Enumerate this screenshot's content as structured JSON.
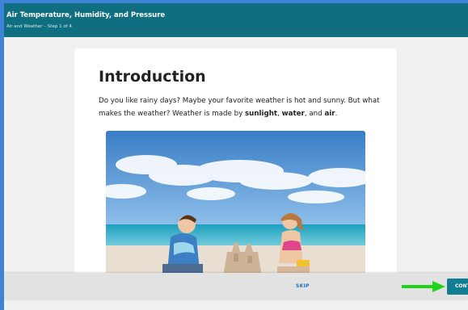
{
  "header": {
    "title": "Air Temperature, Humidity, and Pressure",
    "subtitle": "Air and Weather – Step 1 of 4"
  },
  "lesson": {
    "heading": "Introduction",
    "text_1": "Do you like rainy days? Maybe your favorite weather is hot and sunny. But what makes the weather? Weather is made by ",
    "word_sunlight": "sunlight",
    "sep_1": ", ",
    "word_water": "water",
    "sep_2": ", and ",
    "word_air": "air",
    "end": "."
  },
  "footer": {
    "skip_label": "SKIP",
    "continue_label": "CONTINUE"
  },
  "colors": {
    "header_bg": "#0f6e80",
    "accent_button": "#0f7e93",
    "skip_link": "#1b6fb8",
    "arrow": "#22d419"
  },
  "icons": {
    "pointer_arrow": "arrow-right-icon"
  }
}
